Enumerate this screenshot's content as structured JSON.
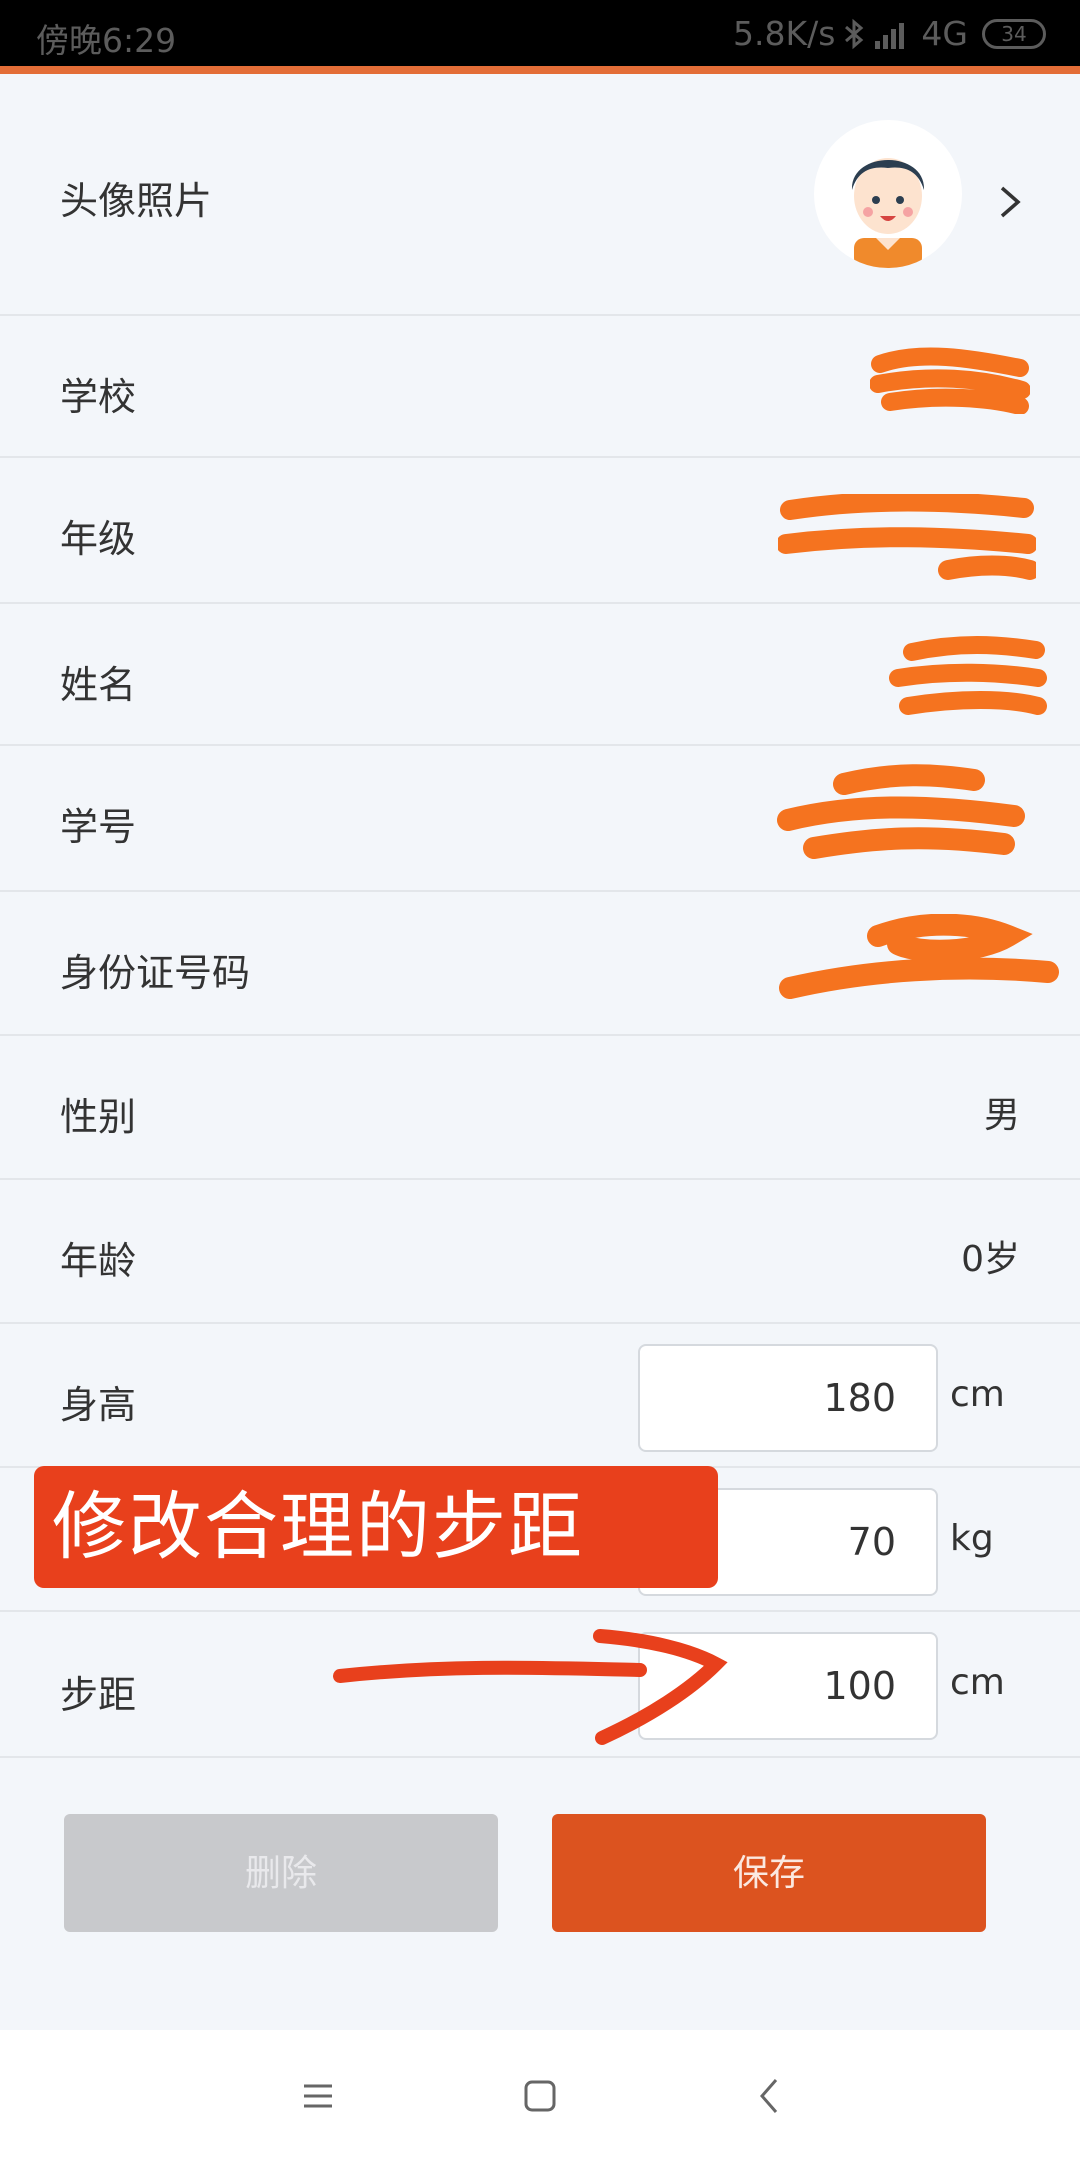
{
  "status_bar": {
    "time": "傍晚6:29",
    "speed": "5.8K/s",
    "network": "4G",
    "battery": "34"
  },
  "rows": {
    "avatar_label": "头像照片",
    "school_label": "学校",
    "grade_label": "年级",
    "name_label": "姓名",
    "student_id_label": "学号",
    "id_card_label": "身份证号码",
    "gender_label": "性别",
    "gender_value": "男",
    "age_label": "年龄",
    "age_value": "0岁",
    "height_label": "身高",
    "height_value": "180",
    "height_unit": "cm",
    "weight_value": "70",
    "weight_unit": "kg",
    "stride_label": "步距",
    "stride_value": "100",
    "stride_unit": "cm"
  },
  "annotation": {
    "text": "修改合理的步距"
  },
  "buttons": {
    "delete": "删除",
    "save": "保存"
  },
  "icons": [
    "chevron-right-icon",
    "bluetooth-icon",
    "signal-icon",
    "battery-icon",
    "menu-icon",
    "home-icon",
    "back-icon"
  ],
  "colors": {
    "accent": "#dc531f",
    "redaction": "#f5731f",
    "annotation": "#e8401c"
  }
}
